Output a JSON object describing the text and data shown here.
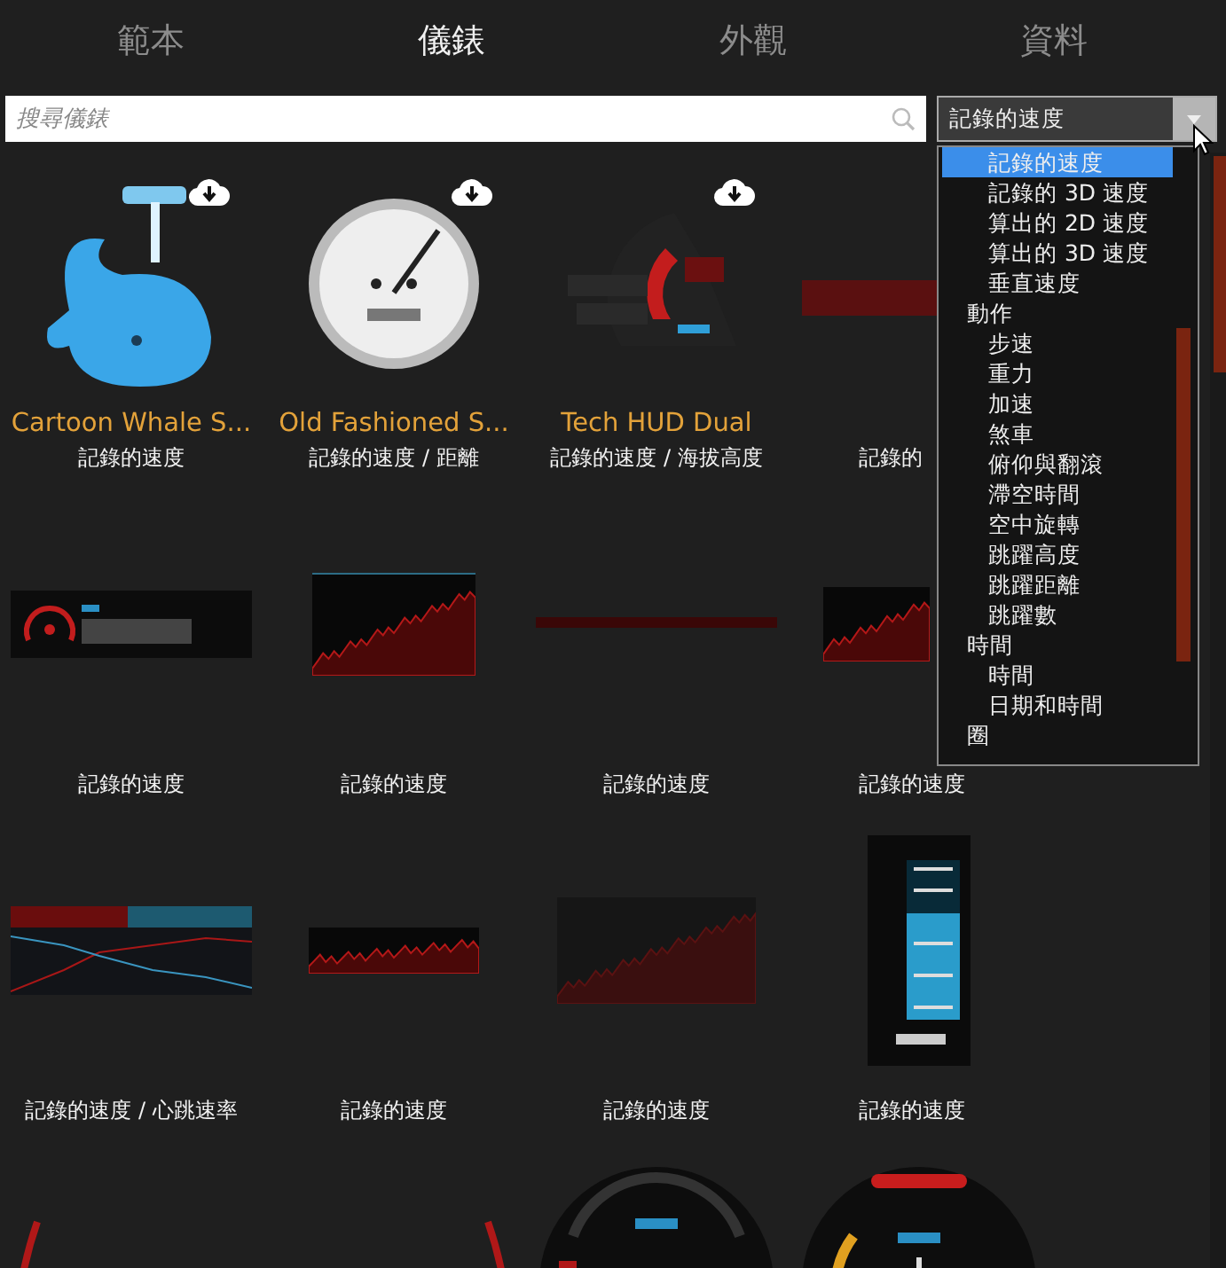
{
  "tabs": [
    {
      "label": "範本",
      "selected": false
    },
    {
      "label": "儀錶",
      "selected": true
    },
    {
      "label": "外觀",
      "selected": false
    },
    {
      "label": "資料",
      "selected": false
    }
  ],
  "search": {
    "placeholder": "搜尋儀錶"
  },
  "filter": {
    "value": "記錄的速度",
    "expanded": true,
    "items": [
      {
        "kind": "option",
        "label": "記錄的速度",
        "selected": true
      },
      {
        "kind": "option",
        "label": "記錄的 3D 速度",
        "selected": false
      },
      {
        "kind": "option",
        "label": "算出的 2D 速度",
        "selected": false
      },
      {
        "kind": "option",
        "label": "算出的 3D 速度",
        "selected": false
      },
      {
        "kind": "option",
        "label": "垂直速度",
        "selected": false
      },
      {
        "kind": "header",
        "label": "動作",
        "selected": false
      },
      {
        "kind": "option",
        "label": "步速",
        "selected": false
      },
      {
        "kind": "option",
        "label": "重力",
        "selected": false
      },
      {
        "kind": "option",
        "label": "加速",
        "selected": false
      },
      {
        "kind": "option",
        "label": "煞車",
        "selected": false
      },
      {
        "kind": "option",
        "label": "俯仰與翻滾",
        "selected": false
      },
      {
        "kind": "option",
        "label": "滯空時間",
        "selected": false
      },
      {
        "kind": "option",
        "label": "空中旋轉",
        "selected": false
      },
      {
        "kind": "option",
        "label": "跳躍高度",
        "selected": false
      },
      {
        "kind": "option",
        "label": "跳躍距離",
        "selected": false
      },
      {
        "kind": "option",
        "label": "跳躍數",
        "selected": false
      },
      {
        "kind": "header",
        "label": "時間",
        "selected": false
      },
      {
        "kind": "option",
        "label": "時間",
        "selected": false
      },
      {
        "kind": "option",
        "label": "日期和時間",
        "selected": false
      },
      {
        "kind": "header",
        "label": "圈",
        "selected": false
      }
    ]
  },
  "gauges": [
    {
      "kind": "whale",
      "title": "Cartoon Whale S...",
      "subtitle": "記錄的速度",
      "download": true
    },
    {
      "kind": "speedometer",
      "title": "Old Fashioned S...",
      "subtitle": "記錄的速度 / 距離",
      "download": true
    },
    {
      "kind": "hud",
      "title": "Tech HUD Dual",
      "subtitle": "記錄的速度 / 海拔高度",
      "download": true
    },
    {
      "kind": "red-banner",
      "subtitle": "記錄的",
      "download": false
    },
    {
      "kind": "speed-box",
      "subtitle": "記錄的速度",
      "download": false
    },
    {
      "kind": "area-chart",
      "subtitle": "記錄的速度",
      "download": false
    },
    {
      "kind": "strip",
      "subtitle": "記錄的速度",
      "download": false
    },
    {
      "kind": "small-chart",
      "subtitle": "記錄的速度",
      "download": false
    },
    {
      "kind": "dual-chart",
      "subtitle": "記錄的速度 / 心跳速率",
      "download": false
    },
    {
      "kind": "wide-chart",
      "subtitle": "記錄的速度",
      "download": false
    },
    {
      "kind": "large-chart",
      "subtitle": "記錄的速度",
      "download": false
    },
    {
      "kind": "bar-gauge",
      "subtitle": "記錄的速度",
      "download": false
    },
    {
      "kind": "arc-left",
      "download": false
    },
    {
      "kind": "arc-right",
      "download": false
    },
    {
      "kind": "round-gauge",
      "download": false
    },
    {
      "kind": "round-gauge-heart",
      "download": false
    }
  ]
}
